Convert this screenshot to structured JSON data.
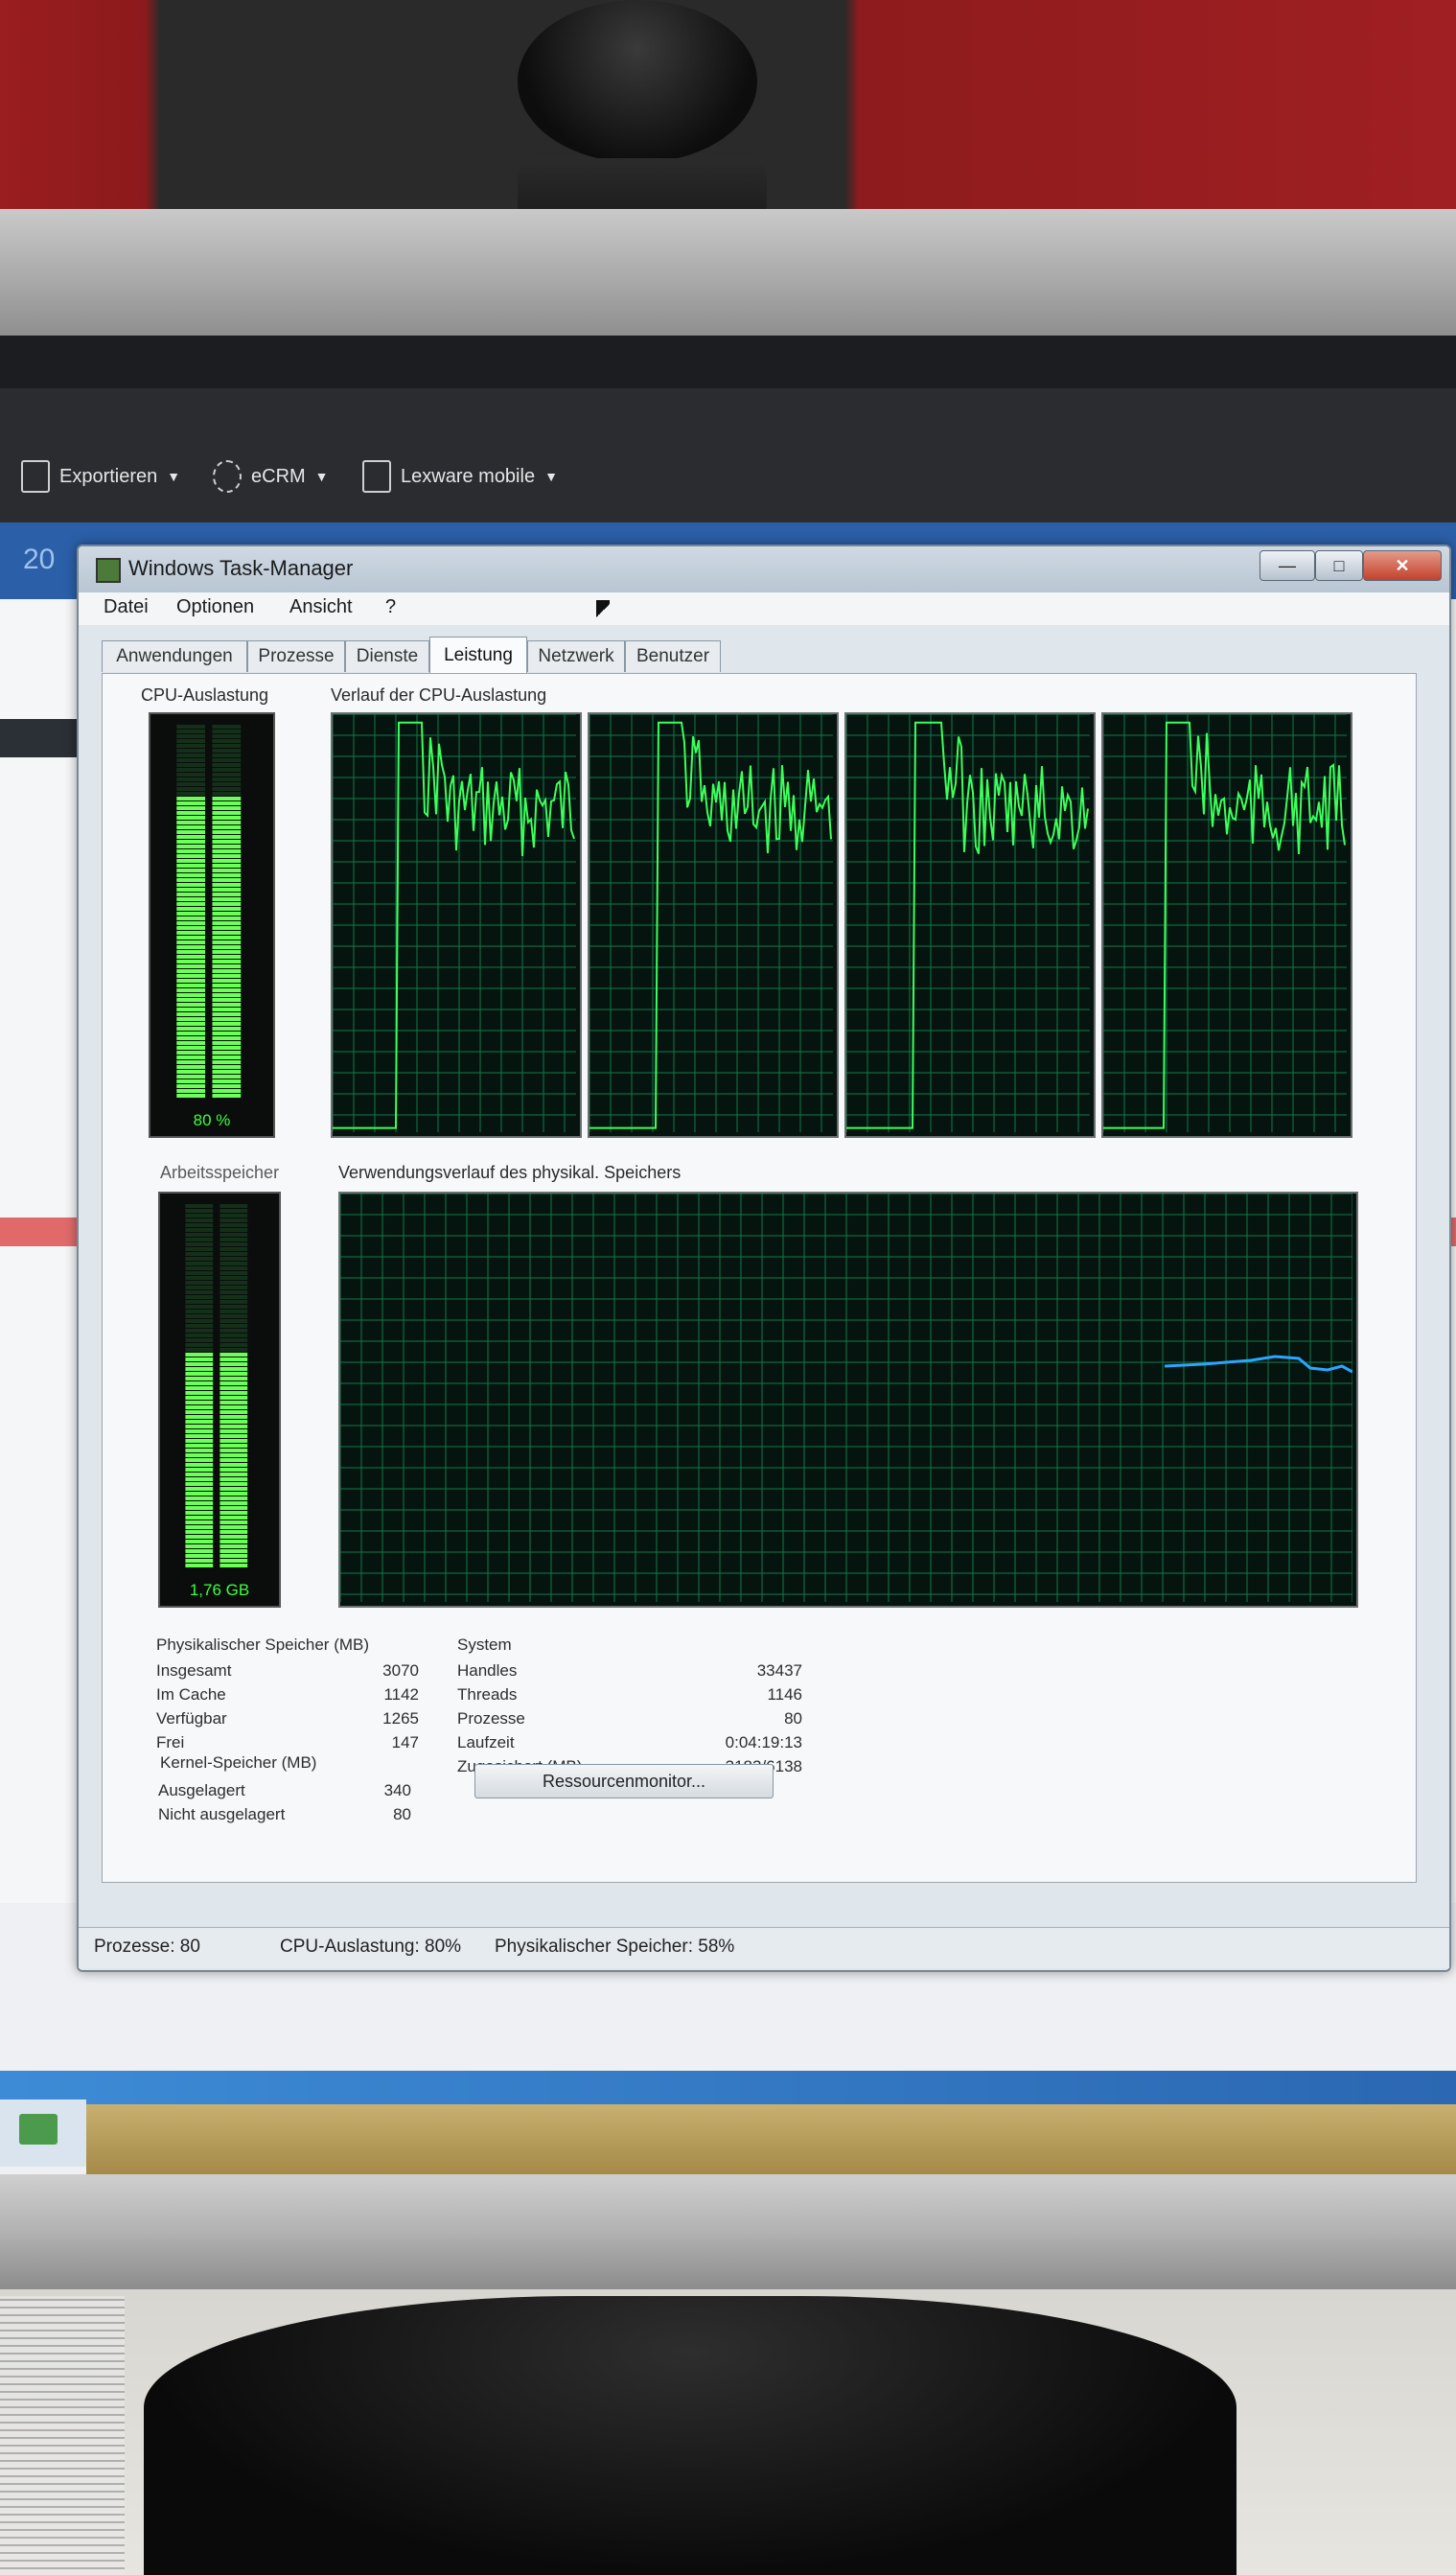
{
  "app_toolbar": {
    "items": [
      {
        "label": "Exportieren",
        "icon": "document-export-icon"
      },
      {
        "label": "eCRM",
        "icon": "crm-cycle-icon"
      },
      {
        "label": "Lexware mobile",
        "icon": "mobile-signal-icon"
      }
    ],
    "date_fragment": "20"
  },
  "window": {
    "title": "Windows Task-Manager",
    "controls": {
      "minimize": "—",
      "maximize": "□",
      "close": "✕"
    }
  },
  "menu": [
    "Datei",
    "Optionen",
    "Ansicht",
    "?"
  ],
  "tabs": [
    {
      "label": "Anwendungen",
      "active": false
    },
    {
      "label": "Prozesse",
      "active": false
    },
    {
      "label": "Dienste",
      "active": false
    },
    {
      "label": "Leistung",
      "active": true
    },
    {
      "label": "Netzwerk",
      "active": false
    },
    {
      "label": "Benutzer",
      "active": false
    }
  ],
  "performance": {
    "cpu_meter_label": "CPU-Auslastung",
    "cpu_meter_value": "80 %",
    "cpu_meter_fraction": 0.8,
    "cpu_history_label": "Verlauf der CPU-Auslastung",
    "mem_meter_label": "Arbeitsspeicher",
    "mem_meter_value": "1,76 GB",
    "mem_meter_fraction": 0.58,
    "mem_history_label": "Verwendungsverlauf des physikal. Speichers",
    "line_color": "#3dff5a",
    "mem_line_color": "#2aa6ff",
    "grid_color": "#0f7a4a"
  },
  "physical_memory": {
    "heading": "Physikalischer Speicher (MB)",
    "rows": [
      {
        "label": "Insgesamt",
        "value": "3070"
      },
      {
        "label": "Im Cache",
        "value": "1142"
      },
      {
        "label": "Verfügbar",
        "value": "1265"
      },
      {
        "label": "Frei",
        "value": "147"
      }
    ]
  },
  "kernel_memory": {
    "heading": "Kernel-Speicher (MB)",
    "rows": [
      {
        "label": "Ausgelagert",
        "value": "340"
      },
      {
        "label": "Nicht ausgelagert",
        "value": "80"
      }
    ]
  },
  "system": {
    "heading": "System",
    "rows": [
      {
        "label": "Handles",
        "value": "33437"
      },
      {
        "label": "Threads",
        "value": "1146"
      },
      {
        "label": "Prozesse",
        "value": "80"
      },
      {
        "label": "Laufzeit",
        "value": "0:04:19:13"
      },
      {
        "label": "Zugesichert (MB)",
        "value": "3183/6138"
      }
    ]
  },
  "resource_monitor_button": "Ressourcenmonitor...",
  "statusbar": {
    "processes": "Prozesse: 80",
    "cpu": "CPU-Auslastung: 80%",
    "memory": "Physikalischer Speicher: 58%"
  }
}
